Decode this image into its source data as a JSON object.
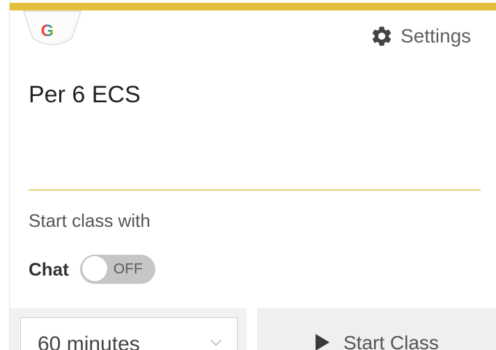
{
  "header": {
    "logo_letter": "G",
    "settings_label": "Settings"
  },
  "class": {
    "title": "Per 6 ECS"
  },
  "start_options": {
    "heading": "Start class with",
    "chat_label": "Chat",
    "chat_toggle_state": "OFF"
  },
  "footer": {
    "duration_value": "60 minutes",
    "start_button_label": "Start Class"
  },
  "colors": {
    "accent": "#e2bf3c",
    "divider": "#e8cf72",
    "google_blue": "#4285F4"
  }
}
